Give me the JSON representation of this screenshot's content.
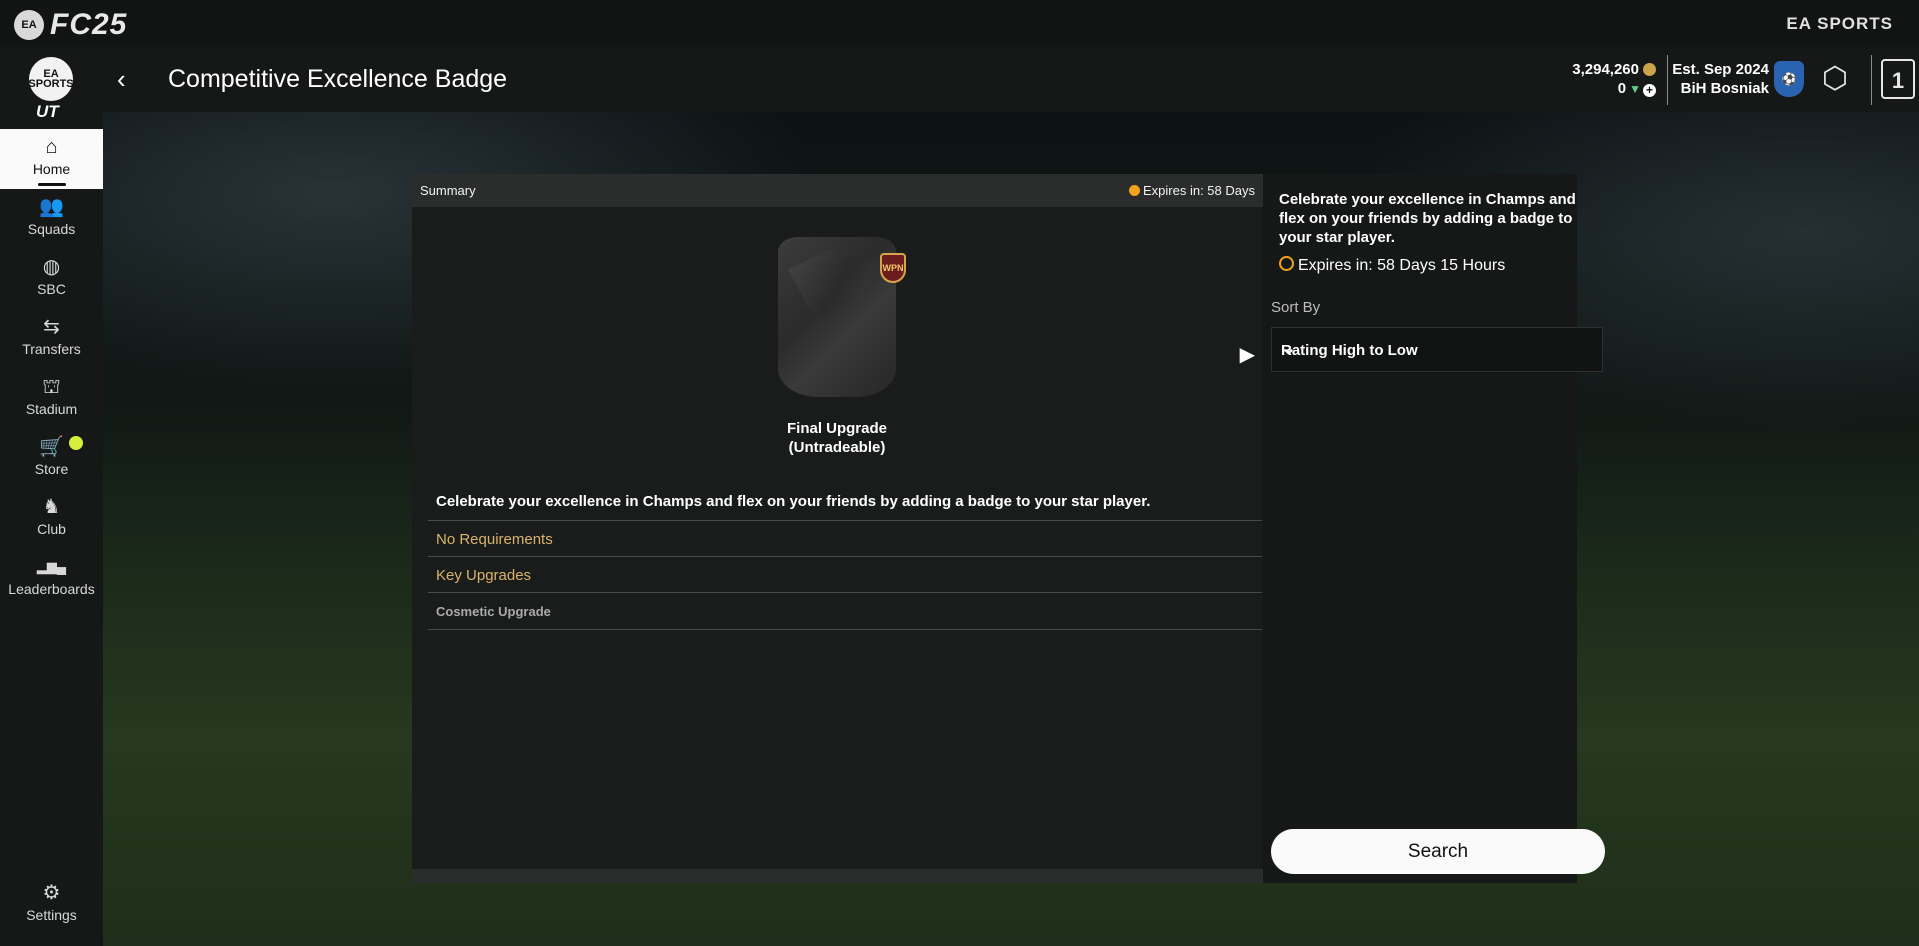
{
  "app": {
    "logo_ea": "EA",
    "logo_title": "FC25",
    "brand": "EA SPORTS",
    "ut_logo": "EA SPORTS",
    "ut_text": "UT"
  },
  "header": {
    "title": "Competitive Excellence Badge",
    "coins": "3,294,260",
    "points": "0",
    "club_est": "Est. Sep 2024",
    "club_name": "BiH Bosniak"
  },
  "sidebar": {
    "items": [
      {
        "label": "Home",
        "icon": "home-icon",
        "glyph": "⌂"
      },
      {
        "label": "Squads",
        "icon": "squads-icon",
        "glyph": "👥"
      },
      {
        "label": "SBC",
        "icon": "sbc-icon",
        "glyph": "◍"
      },
      {
        "label": "Transfers",
        "icon": "transfers-icon",
        "glyph": "⇆"
      },
      {
        "label": "Stadium",
        "icon": "stadium-icon",
        "glyph": "⛫"
      },
      {
        "label": "Store",
        "icon": "cart-icon",
        "glyph": "🛒"
      },
      {
        "label": "Club",
        "icon": "club-icon",
        "glyph": "♞"
      },
      {
        "label": "Leaderboards",
        "icon": "leaderboard-icon",
        "glyph": "▂▆▄"
      }
    ],
    "settings": {
      "label": "Settings",
      "icon": "gear-icon",
      "glyph": "⚙"
    }
  },
  "summary": {
    "label": "Summary",
    "expires_short": "Expires in: 58 Days",
    "reward_line1": "Final Upgrade",
    "reward_line2": "(Untradeable)",
    "badge_text": "WPN",
    "description": "Celebrate your excellence in Champs and flex on your friends by adding a badge to your star player.",
    "requirements": [
      {
        "label": "No Requirements"
      },
      {
        "label": "Key Upgrades"
      },
      {
        "label": "Cosmetic Upgrade"
      }
    ]
  },
  "side": {
    "description": "Celebrate your excellence in Champs and flex on your friends by adding a badge to your star player.",
    "expires_long": "Expires in: 58 Days 15 Hours",
    "sort_label": "Sort By",
    "sort_value": "Rating High to Low",
    "search_label": "Search"
  },
  "colors": {
    "accent_gold": "#d8b46a",
    "timer_orange": "#f2a31a",
    "store_dot": "#d4ee3a"
  }
}
